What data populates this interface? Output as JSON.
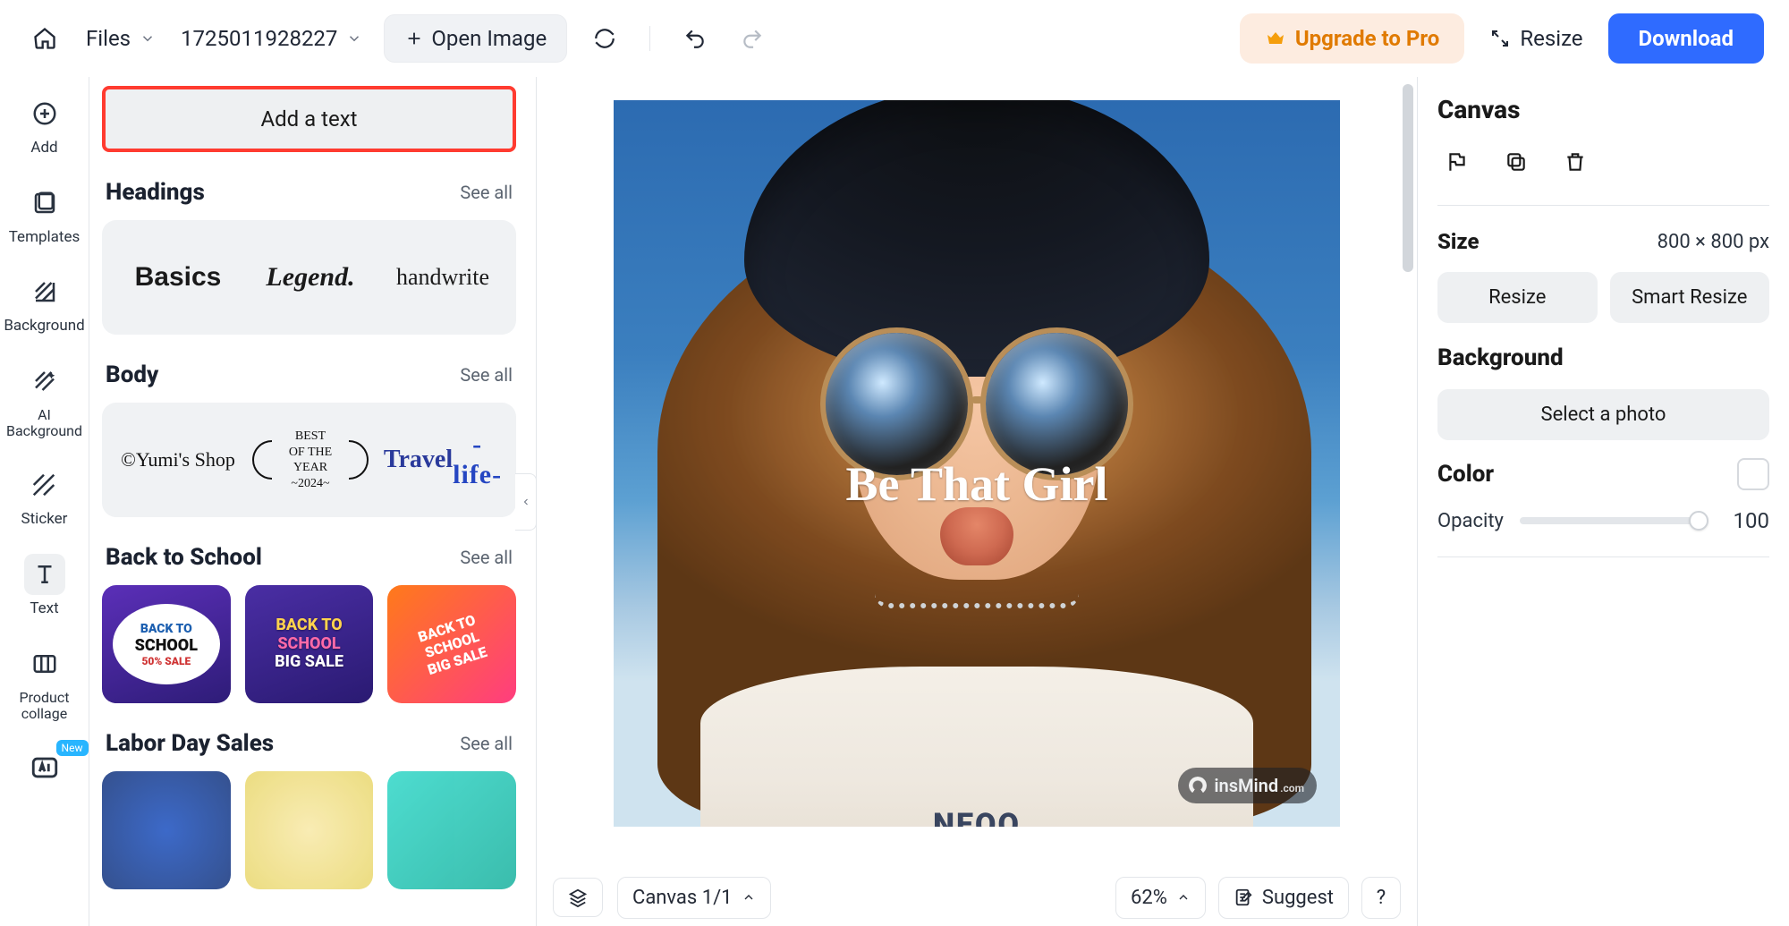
{
  "topbar": {
    "files_label": "Files",
    "doc_name": "1725011928227",
    "open_image": "Open Image",
    "upgrade": "Upgrade to Pro",
    "resize": "Resize",
    "download": "Download"
  },
  "rail": {
    "add": "Add",
    "templates": "Templates",
    "background": "Background",
    "ai_background": "AI\nBackground",
    "sticker": "Sticker",
    "text": "Text",
    "product_collage": "Product\ncollage",
    "new_badge": "New"
  },
  "left": {
    "add_text": "Add a text",
    "sections": {
      "headings": {
        "title": "Headings",
        "see_all": "See all",
        "thumbs": [
          "Basics",
          "Legend.",
          "handwrite"
        ]
      },
      "body": {
        "title": "Body",
        "see_all": "See all",
        "thumbs": [
          "©Yumi's Shop",
          "BEST\nOF THE YEAR\n~2024~",
          "Travel\n-life-"
        ]
      },
      "back_to_school": {
        "title": "Back to School",
        "see_all": "See all",
        "t1": {
          "l1": "BACK TO",
          "l2": "SCHOOL",
          "l3": "50% SALE"
        },
        "t2": {
          "l1": "BACK TO",
          "l2": "SCHOOL",
          "l3": "BIG SALE"
        },
        "t3": {
          "l1": "BACK TO",
          "l2": "SCHOOL",
          "l3": "BIG SALE"
        }
      },
      "labor_day": {
        "title": "Labor Day Sales",
        "see_all": "See all"
      }
    }
  },
  "canvas": {
    "headline": "Be That Girl",
    "tee_logo": "NEOO",
    "watermark": "insMind",
    "watermark_suffix": ".com",
    "footer": {
      "canvas_dd": "Canvas 1/1",
      "zoom": "62%",
      "suggest": "Suggest",
      "help": "?"
    }
  },
  "right": {
    "title": "Canvas",
    "size_label": "Size",
    "size_value": "800 × 800 px",
    "resize": "Resize",
    "smart_resize": "Smart Resize",
    "background": "Background",
    "select_photo": "Select a photo",
    "color_label": "Color",
    "opacity_label": "Opacity",
    "opacity_value": "100"
  }
}
